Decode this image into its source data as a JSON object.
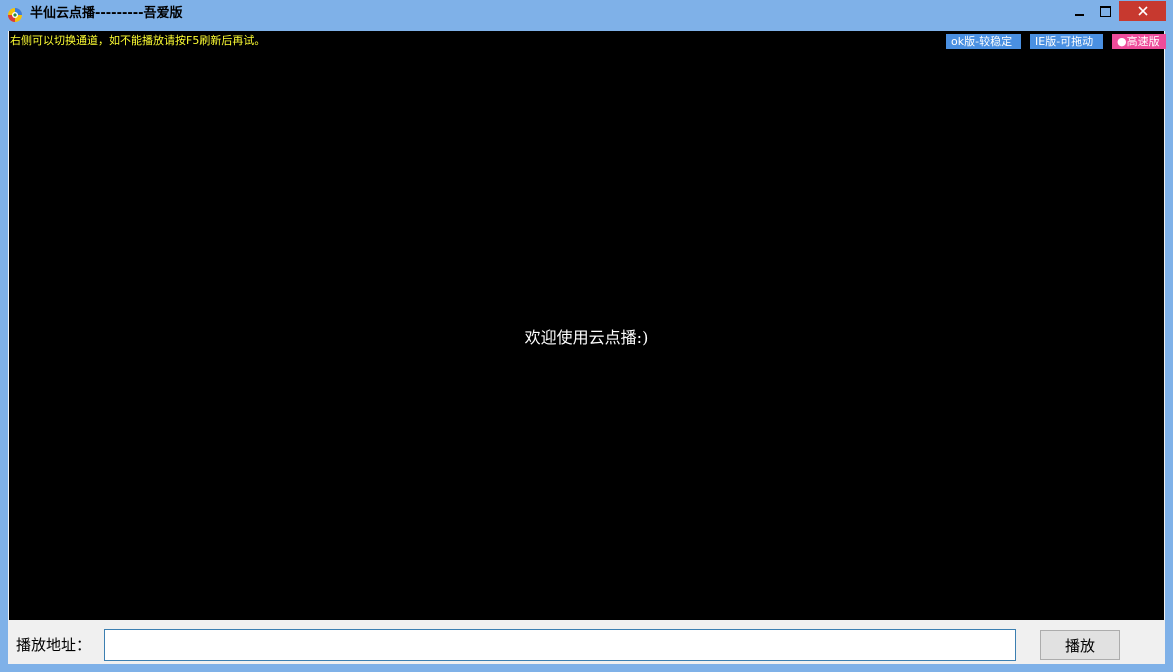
{
  "window": {
    "title": "半仙云点播---------吾爱版",
    "icon": "app-logo-icon",
    "close_color": "#c7392f"
  },
  "player": {
    "hint": "右侧可以切换通道，如不能播放请按F5刷新后再试。",
    "welcome": "欢迎使用云点播:)",
    "channels": [
      {
        "label": "ok版-较稳定",
        "color": "#4a90e2"
      },
      {
        "label": "IE版-可拖动",
        "color": "#4a90e2"
      },
      {
        "label": "●高速版",
        "color": "#ee4c9a"
      }
    ]
  },
  "bottom": {
    "address_label": "播放地址：",
    "address_value": "",
    "play_label": "播放"
  }
}
